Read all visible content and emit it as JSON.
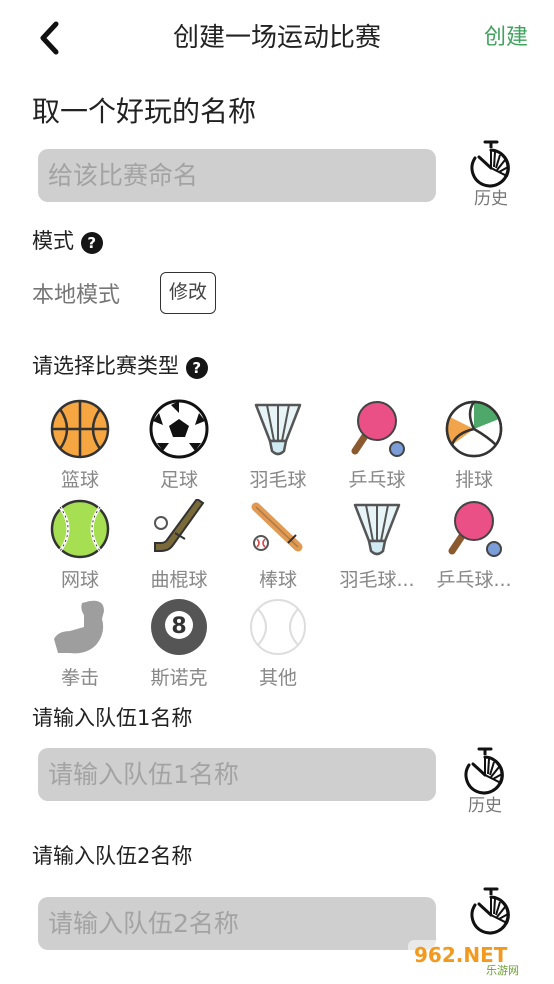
{
  "header": {
    "title": "创建一场运动比赛",
    "create_label": "创建"
  },
  "name_section": {
    "heading": "取一个好玩的名称",
    "placeholder": "给该比赛命名",
    "history_label": "历史"
  },
  "mode_section": {
    "label": "模式",
    "help": "?",
    "value": "本地模式",
    "modify_label": "修改"
  },
  "type_section": {
    "label": "请选择比赛类型",
    "help": "?",
    "sports": [
      {
        "label": "篮球",
        "icon": "basketball-icon"
      },
      {
        "label": "足球",
        "icon": "soccer-ball-icon"
      },
      {
        "label": "羽毛球",
        "icon": "shuttlecock-icon"
      },
      {
        "label": "乒乓球",
        "icon": "ping-pong-icon"
      },
      {
        "label": "排球",
        "icon": "volleyball-icon"
      },
      {
        "label": "网球",
        "icon": "tennis-ball-icon"
      },
      {
        "label": "曲棍球",
        "icon": "hockey-icon"
      },
      {
        "label": "棒球",
        "icon": "baseball-icon"
      },
      {
        "label": "羽毛球...",
        "icon": "shuttlecock-icon"
      },
      {
        "label": "乒乓球...",
        "icon": "ping-pong-icon"
      },
      {
        "label": "拳击",
        "icon": "boxing-arm-icon"
      },
      {
        "label": "斯诺克",
        "icon": "billiard-ball-icon"
      },
      {
        "label": "其他",
        "icon": "other-ball-icon"
      }
    ]
  },
  "team1": {
    "label": "请输入队伍1名称",
    "placeholder": "请输入队伍1名称",
    "history_label": "历史"
  },
  "team2": {
    "label": "请输入队伍2名称",
    "placeholder": "请输入队伍2名称"
  },
  "watermark": {
    "text": "962.NET",
    "subtext": "乐游网"
  },
  "colors": {
    "accent": "#3fa35e",
    "input_bg": "#cfcfcf"
  }
}
